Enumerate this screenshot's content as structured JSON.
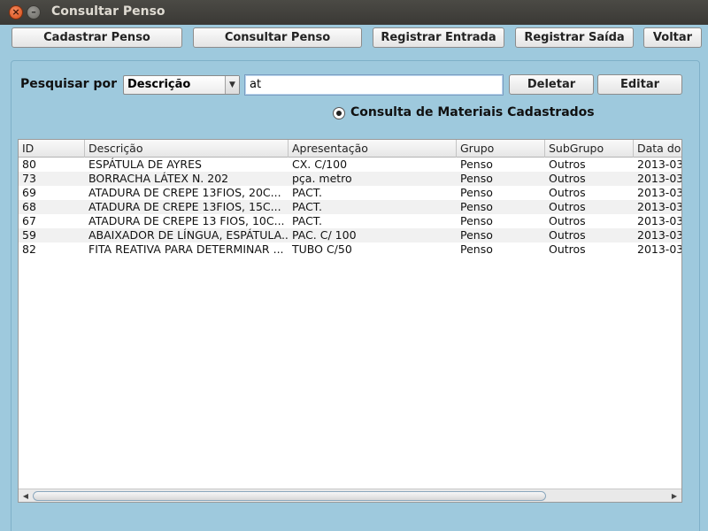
{
  "window": {
    "title": "Consultar Penso"
  },
  "toolbar": {
    "buttons": [
      {
        "label": "Cadastrar Penso"
      },
      {
        "label": "Consultar Penso"
      },
      {
        "label": "Registrar Entrada"
      },
      {
        "label": "Registrar Saída"
      },
      {
        "label": "Voltar"
      }
    ]
  },
  "search": {
    "label": "Pesquisar por",
    "field_selected": "Descrição",
    "query": "at",
    "delete_label": "Deletar",
    "edit_label": "Editar",
    "radio_label": "Consulta de Materiais Cadastrados",
    "radio_checked": true
  },
  "table": {
    "columns": [
      "ID",
      "Descrição",
      "Apresentação",
      "Grupo",
      "SubGrupo",
      "Data do"
    ],
    "rows": [
      [
        "80",
        "ESPÁTULA DE AYRES",
        "CX. C/100",
        "Penso",
        "Outros",
        "2013-03"
      ],
      [
        "73",
        "BORRACHA LÁTEX N. 202",
        "pça. metro",
        "Penso",
        "Outros",
        "2013-03"
      ],
      [
        "69",
        "ATADURA DE CREPE 13FIOS, 20C...",
        "PACT.",
        "Penso",
        "Outros",
        "2013-03"
      ],
      [
        "68",
        "ATADURA DE CREPE 13FIOS, 15C...",
        "PACT.",
        "Penso",
        "Outros",
        "2013-03"
      ],
      [
        "67",
        "ATADURA DE CREPE 13 FIOS, 10C...",
        "PACT.",
        "Penso",
        "Outros",
        "2013-03"
      ],
      [
        "59",
        "ABAIXADOR DE LÍNGUA, ESPÁTULA...",
        "PAC. C/ 100",
        "Penso",
        "Outros",
        "2013-03"
      ],
      [
        "82",
        "FITA REATIVA PARA DETERMINAR ...",
        "TUBO C/50",
        "Penso",
        "Outros",
        "2013-03"
      ]
    ]
  },
  "colors": {
    "background": "#9ec9dd",
    "titlebar": "#3c3b37",
    "close": "#e05a23"
  }
}
